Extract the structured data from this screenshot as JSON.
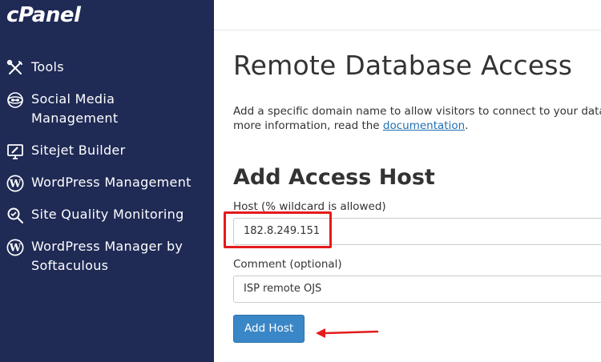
{
  "app": {
    "logo": "cPanel"
  },
  "sidebar": {
    "items": [
      {
        "label": "Tools",
        "icon": "tools-icon"
      },
      {
        "label": "Social Media Management",
        "icon": "social-media-icon"
      },
      {
        "label": "Sitejet Builder",
        "icon": "sitejet-icon"
      },
      {
        "label": "WordPress Management",
        "icon": "wordpress-icon"
      },
      {
        "label": "Site Quality Monitoring",
        "icon": "magnifier-icon"
      },
      {
        "label": "WordPress Manager by Softaculous",
        "icon": "wordpress-icon"
      }
    ]
  },
  "page": {
    "title": "Remote Database Access",
    "description_prefix": "Add a specific domain name to allow visitors to connect to your databa",
    "description_line2_prefix": "more information, read the ",
    "description_link": "documentation",
    "description_suffix": "."
  },
  "form": {
    "section_title": "Add Access Host",
    "host_label": "Host (% wildcard is allowed)",
    "host_value": "182.8.249.151",
    "comment_label": "Comment (optional)",
    "comment_value": "ISP remote OJS",
    "submit_label": "Add Host"
  },
  "colors": {
    "sidebar_bg": "#1f2a55",
    "button_bg": "#3a87c8",
    "link": "#1f6fb2",
    "annotation": "#e31b1b"
  }
}
